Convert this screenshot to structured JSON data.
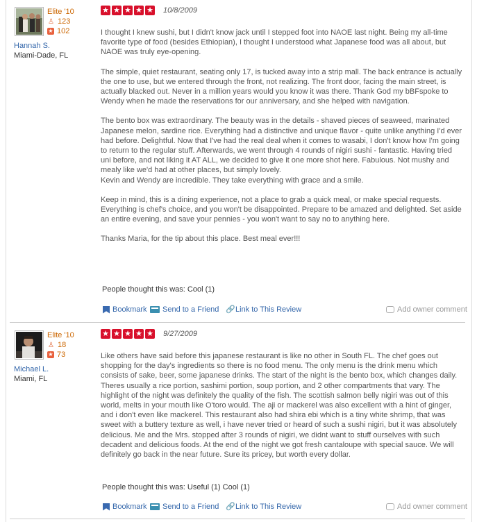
{
  "colors": {
    "accent": "#3366aa",
    "star": "#d8102b",
    "elite": "#cc6600"
  },
  "reviews": [
    {
      "user": {
        "elite": "Elite '10",
        "friends": "123",
        "reviews": "102",
        "name": "Hannah S.",
        "location": "Miami-Dade, FL",
        "friends_icon": "friends-icon",
        "reviews_icon": "reviews-icon"
      },
      "rating": 5,
      "date": "10/8/2009",
      "paragraphs": [
        "I thought I knew sushi, but I didn't know jack until I stepped foot into NAOE last night. Being my all-time favorite type of food (besides Ethiopian), I thought I understood what Japanese food was all about, but NAOE was truly eye-opening.",
        "The simple, quiet restaurant, seating only 17, is tucked away into a strip mall. The back entrance is actually the one to use, but we entered through the front, not realizing. The front door, facing the main street, is actually blacked out. Never in a million years would you know it was there. Thank God my bBFspoke to Wendy when he made the reservations for our anniversary, and she helped with navigation.",
        "The bento box was extraordinary. The beauty was in the details - shaved pieces of seaweed, marinated Japanese melon, sardine rice. Everything had a distinctive and unique flavor - quite unlike anything I'd ever had before. Delightful. Now that I've had the real deal when it comes to wasabi, I don't know how I'm going to return to the regular stuff. Afterwards, we went through 4 rounds of nigiri sushi - fantastic. Having tried uni before, and not liking it AT ALL, we decided to give it one more shot here. Fabulous. Not mushy and mealy like we'd had at other places, but simply lovely.\nKevin and Wendy are incredible. They take everything with grace and a smile.",
        "Keep in mind, this is a dining experience, not a place to grab a quick meal, or make special requests. Everything is chef's choice, and you won't be disappointed. Prepare to be amazed and delighted. Set aside an entire evening, and save your pennies - you won't want to say no to anything here.",
        "Thanks Maria, for the tip about this place. Best meal ever!!!"
      ],
      "thought": "People thought this was: Cool (1)",
      "actions": {
        "bookmark": "Bookmark",
        "send": "Send to a Friend",
        "link": "Link to This Review",
        "owner": "Add owner comment"
      }
    },
    {
      "user": {
        "elite": "Elite '10",
        "friends": "18",
        "reviews": "73",
        "name": "Michael L.",
        "location": "Miami, FL",
        "friends_icon": "friends-icon",
        "reviews_icon": "reviews-icon"
      },
      "rating": 5,
      "date": "9/27/2009",
      "paragraphs": [
        "Like others have said before this japanese restaurant is like no other in South FL.  The chef goes out shopping for the day's ingredients so there is no food menu.  The only menu is the drink menu which consists of sake, beer, some japanese drinks.  The start of the night is the bento box, which changes daily.  Theres usually a rice portion, sashimi portion, soup portion, and 2 other compartments that vary.  The highlight of the night was definitely the quality of the fish.  The scottish salmon belly nigiri was out of this world, melts in your mouth like O'toro would. The aji or mackerel was also excellent with a hint of ginger, and i don't even like mackerel.  This restaurant also had shira ebi which is a tiny white shrimp, that was sweet with a buttery texture as well, i have never tried or heard of such a sushi nigiri, but it was absolutely delicious.  Me and the Mrs. stopped after 3 rounds of nigiri, we didnt want to stuff ourselves with such decadent and delicious foods.  At the end of the night we got fresh cantaloupe with special sauce.  We will definitely go back  in the near future.  Sure its pricey, but  worth every dollar."
      ],
      "thought": "People thought this was: Useful (1)   Cool (1)",
      "actions": {
        "bookmark": "Bookmark",
        "send": "Send to a Friend",
        "link": "Link to This Review",
        "owner": "Add owner comment"
      }
    }
  ]
}
